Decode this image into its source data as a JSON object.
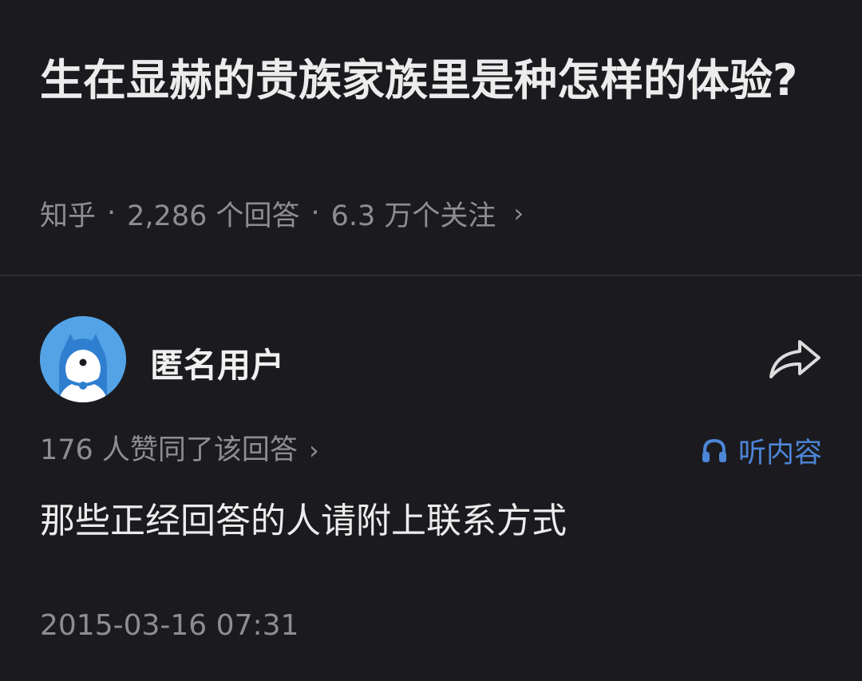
{
  "question": {
    "title": "生在显赫的贵族家族里是种怎样的体验?",
    "meta": {
      "source": "知乎",
      "answer_count": "2,286 个回答",
      "follower_count": "6.3 万个关注"
    }
  },
  "answer": {
    "author": {
      "name": "匿名用户",
      "avatar_icon": "anonymous-mascot-avatar"
    },
    "share_icon": "share-arrow-icon",
    "vote_summary": "176 人赞同了该回答",
    "listen_label": "听内容",
    "listen_icon": "headphones-icon",
    "content": "那些正经回答的人请附上联系方式",
    "date": "2015-03-16 07:31"
  },
  "colors": {
    "background": "#1b1b1f",
    "primary_text": "#ececec",
    "secondary_text": "#8d8d93",
    "accent": "#4d86d8",
    "avatar_bg": "#53a3e6"
  }
}
